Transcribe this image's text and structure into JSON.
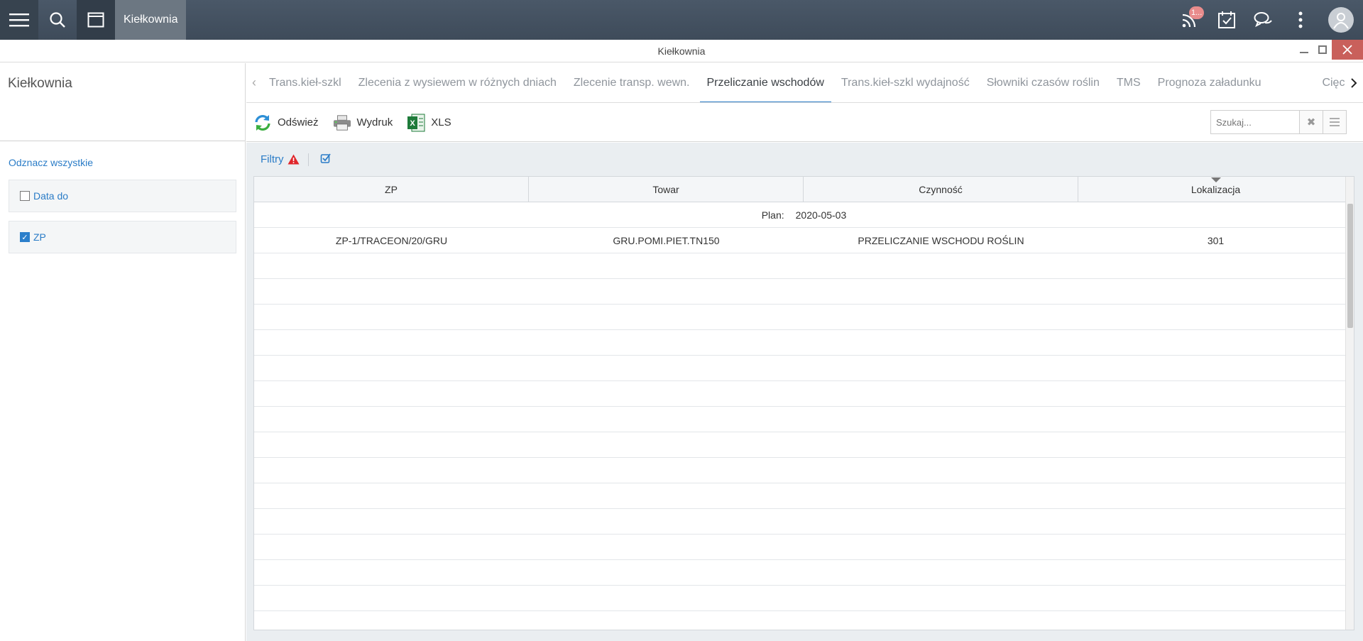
{
  "topbar": {
    "app_label": "Kiełkownia",
    "notification_badge": "1..."
  },
  "window": {
    "title": "Kiełkownia"
  },
  "left_panel": {
    "title": "Kiełkownia",
    "unselect_all": "Odznacz wszystkie",
    "filters": [
      {
        "label": "Data do",
        "checked": false
      },
      {
        "label": "ZP",
        "checked": true
      }
    ]
  },
  "tabs": [
    {
      "label": "Trans.kieł-szkl",
      "active": false
    },
    {
      "label": "Zlecenia z wysiewem w różnych dniach",
      "active": false
    },
    {
      "label": "Zlecenie transp. wewn.",
      "active": false
    },
    {
      "label": "Przeliczanie wschodów",
      "active": true
    },
    {
      "label": "Trans.kieł-szkl wydajność",
      "active": false
    },
    {
      "label": "Słowniki czasów roślin",
      "active": false
    },
    {
      "label": "TMS",
      "active": false
    },
    {
      "label": "Prognoza załadunku",
      "active": false
    },
    {
      "label": "Cięci",
      "active": false
    }
  ],
  "toolbar": {
    "refresh": "Odśwież",
    "print": "Wydruk",
    "xls": "XLS",
    "search_placeholder": "Szukaj..."
  },
  "filterbar": {
    "label": "Filtry"
  },
  "grid": {
    "columns": [
      "ZP",
      "Towar",
      "Czynność",
      "Lokalizacja"
    ],
    "sorted_column": "Lokalizacja",
    "group": {
      "label": "Plan:",
      "value": "2020-05-03"
    },
    "rows": [
      [
        "ZP-1/TRACEON/20/GRU",
        "GRU.POMI.PIET.TN150",
        "PRZELICZANIE WSCHODU ROŚLIN",
        "301"
      ]
    ],
    "empty_rows": 15
  },
  "colors": {
    "accent": "#2a7cc7",
    "topbar": "#434f5d",
    "close": "#c9605b",
    "warning": "#e0262b"
  }
}
